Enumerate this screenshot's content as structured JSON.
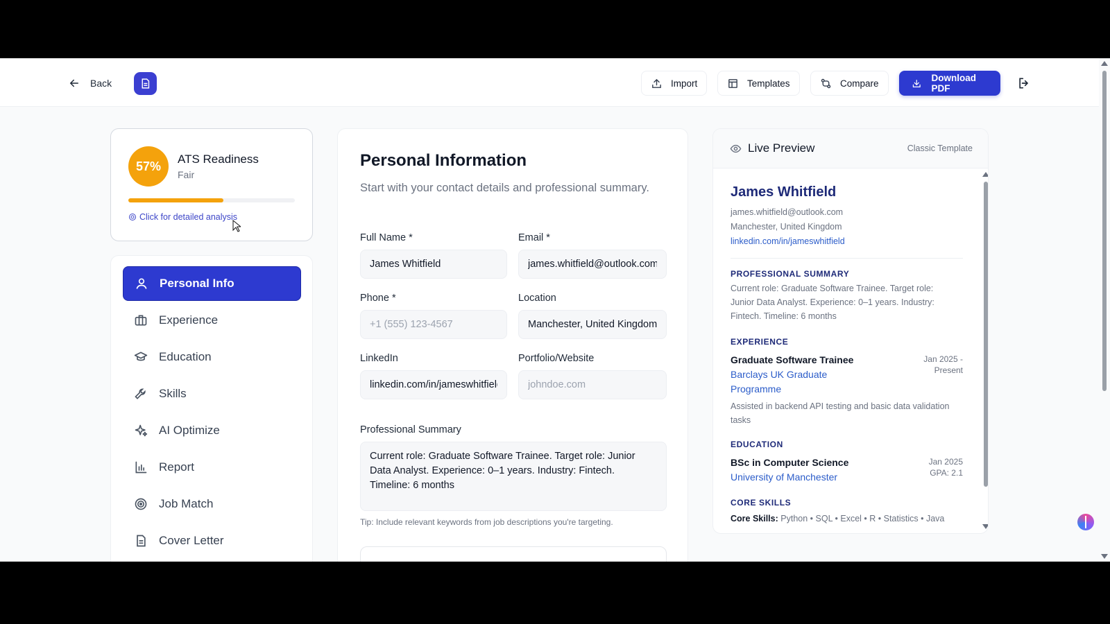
{
  "topbar": {
    "back_label": "Back",
    "import_label": "Import",
    "templates_label": "Templates",
    "compare_label": "Compare",
    "download_label": "Download PDF",
    "accent_color": "#2d3ad0"
  },
  "ats": {
    "score": "57%",
    "score_fraction": 0.57,
    "title": "ATS Readiness",
    "rating": "Fair",
    "link": "Click for detailed analysis",
    "color": "#f4a20c"
  },
  "nav": {
    "items": [
      {
        "label": "Personal Info",
        "icon": "user-icon",
        "active": true
      },
      {
        "label": "Experience",
        "icon": "briefcase-icon"
      },
      {
        "label": "Education",
        "icon": "graduation-cap-icon"
      },
      {
        "label": "Skills",
        "icon": "wrench-icon"
      },
      {
        "label": "AI Optimize",
        "icon": "sparkles-icon"
      },
      {
        "label": "Report",
        "icon": "bar-chart-icon"
      },
      {
        "label": "Job Match",
        "icon": "target-icon"
      },
      {
        "label": "Cover Letter",
        "icon": "document-icon"
      }
    ]
  },
  "form": {
    "title": "Personal Information",
    "subtitle": "Start with your contact details and professional summary.",
    "full_name": {
      "label": "Full Name *",
      "value": "James Whitfield"
    },
    "email": {
      "label": "Email *",
      "value": "james.whitfield@outlook.com"
    },
    "phone": {
      "label": "Phone *",
      "placeholder": "+1 (555) 123-4567"
    },
    "location": {
      "label": "Location",
      "value": "Manchester, United Kingdom"
    },
    "linkedin": {
      "label": "LinkedIn",
      "value": "linkedin.com/in/jameswhitfield"
    },
    "portfolio": {
      "label": "Portfolio/Website",
      "placeholder": "johndoe.com"
    },
    "summary": {
      "label": "Professional Summary",
      "value": "Current role: Graduate Software Trainee. Target role: Junior Data Analyst. Experience: 0–1 years. Industry: Fintech. Timeline: 6 months"
    },
    "tip": "Tip: Include relevant keywords from job descriptions you're targeting."
  },
  "preview": {
    "title": "Live Preview",
    "template": "Classic Template",
    "name": "James Whitfield",
    "email": "james.whitfield@outlook.com",
    "location": "Manchester, United Kingdom",
    "linkedin": "linkedin.com/in/jameswhitfield",
    "summary_heading": "PROFESSIONAL SUMMARY",
    "summary": "Current role: Graduate Software Trainee. Target role: Junior Data Analyst. Experience: 0–1 years. Industry: Fintech. Timeline: 6 months",
    "experience_heading": "EXPERIENCE",
    "job_title": "Graduate Software Trainee",
    "job_org": "Barclays UK Graduate Programme",
    "job_dates": "Jan 2025 - Present",
    "job_desc": "Assisted in backend API testing and basic data validation tasks",
    "education_heading": "EDUCATION",
    "degree": "BSc in Computer Science",
    "school": "University of Manchester",
    "edu_date": "Jan 2025",
    "gpa": "GPA: 2.1",
    "skills_heading": "CORE SKILLS",
    "skills_label": "Core Skills:",
    "skills": "Python • SQL • Excel • R • Statistics • Java"
  }
}
